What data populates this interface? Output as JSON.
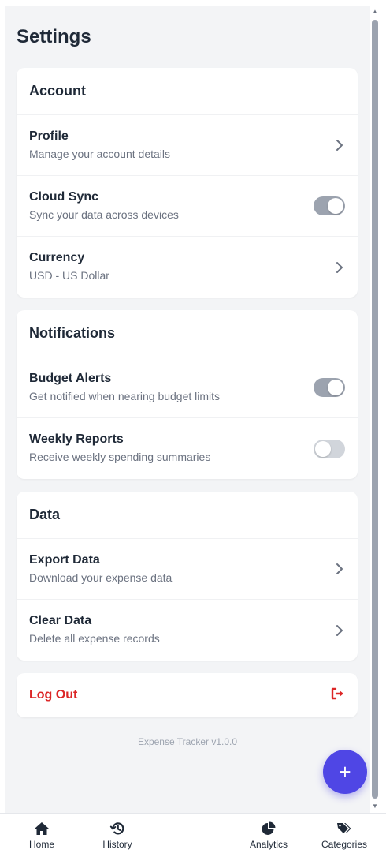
{
  "page": {
    "title": "Settings"
  },
  "account": {
    "header": "Account",
    "profile": {
      "label": "Profile",
      "sub": "Manage your account details"
    },
    "cloud_sync": {
      "label": "Cloud Sync",
      "sub": "Sync your data across devices",
      "enabled": true
    },
    "currency": {
      "label": "Currency",
      "sub": "USD - US Dollar"
    }
  },
  "notifications": {
    "header": "Notifications",
    "budget_alerts": {
      "label": "Budget Alerts",
      "sub": "Get notified when nearing budget limits",
      "enabled": true
    },
    "weekly_reports": {
      "label": "Weekly Reports",
      "sub": "Receive weekly spending summaries",
      "enabled": false
    }
  },
  "data_section": {
    "header": "Data",
    "export": {
      "label": "Export Data",
      "sub": "Download your expense data"
    },
    "clear": {
      "label": "Clear Data",
      "sub": "Delete all expense records"
    }
  },
  "logout": {
    "label": "Log Out",
    "icon": "logout-icon"
  },
  "footer": {
    "version": "Expense Tracker v1.0.0"
  },
  "fab": {
    "symbol": "+",
    "icon": "plus-icon"
  },
  "nav": {
    "items": [
      {
        "label": "Home",
        "icon": "home-icon"
      },
      {
        "label": "History",
        "icon": "history-icon"
      },
      {
        "label": "Analytics",
        "icon": "pie-chart-icon"
      },
      {
        "label": "Categories",
        "icon": "tags-icon"
      }
    ]
  },
  "colors": {
    "accent": "#4f46e5",
    "danger": "#dc2626",
    "background": "#f3f4f6",
    "muted_text": "#6b7280",
    "toggle_on": "#9ca3af",
    "toggle_off": "#d1d5db"
  }
}
